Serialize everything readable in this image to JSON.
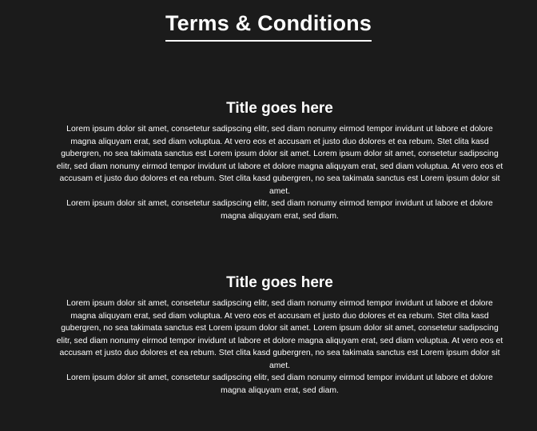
{
  "page": {
    "title": "Terms & Conditions"
  },
  "sections": [
    {
      "title": "Title goes here",
      "body": "Lorem ipsum dolor sit amet, consetetur sadipscing elitr, sed diam nonumy eirmod tempor invidunt ut labore et dolore magna aliquyam erat, sed diam voluptua. At vero eos et accusam et justo duo dolores et ea rebum. Stet clita kasd gubergren, no sea takimata sanctus est Lorem ipsum dolor sit amet. Lorem ipsum dolor sit amet, consetetur sadipscing elitr, sed diam nonumy eirmod tempor invidunt ut labore et dolore magna aliquyam erat, sed diam voluptua. At vero eos et accusam et justo duo dolores et ea rebum. Stet clita kasd gubergren, no sea takimata sanctus est Lorem ipsum dolor sit amet.\nLorem ipsum dolor sit amet, consetetur sadipscing elitr, sed diam nonumy eirmod tempor invidunt ut labore et dolore magna aliquyam erat, sed diam."
    },
    {
      "title": "Title goes here",
      "body": "Lorem ipsum dolor sit amet, consetetur sadipscing elitr, sed diam nonumy eirmod tempor invidunt ut labore et dolore magna aliquyam erat, sed diam voluptua. At vero eos et accusam et justo duo dolores et ea rebum. Stet clita kasd gubergren, no sea takimata sanctus est Lorem ipsum dolor sit amet. Lorem ipsum dolor sit amet, consetetur sadipscing elitr, sed diam nonumy eirmod tempor invidunt ut labore et dolore magna aliquyam erat, sed diam voluptua. At vero eos et accusam et justo duo dolores et ea rebum. Stet clita kasd gubergren, no sea takimata sanctus est Lorem ipsum dolor sit amet.\nLorem ipsum dolor sit amet, consetetur sadipscing elitr, sed diam nonumy eirmod tempor invidunt ut labore et dolore magna aliquyam erat, sed diam."
    }
  ]
}
